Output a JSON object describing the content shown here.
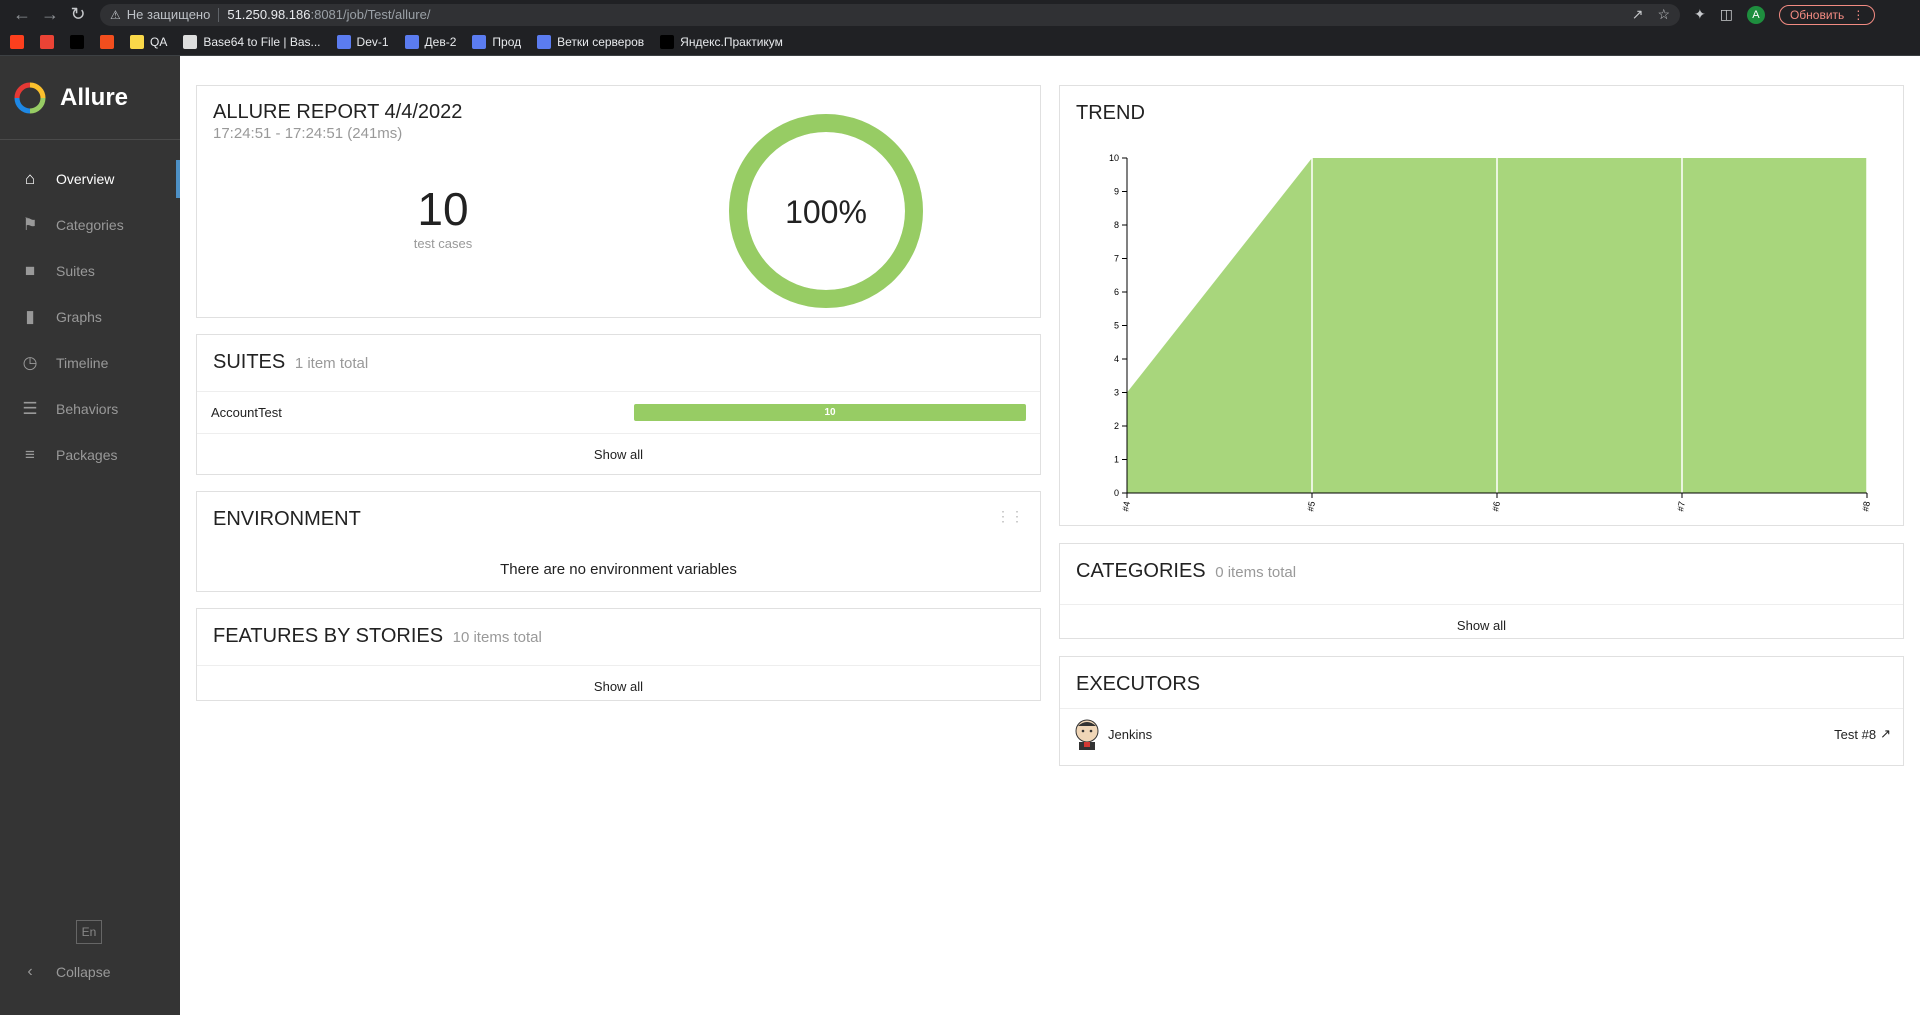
{
  "browser": {
    "security_label": "Не защищено",
    "url_host": "51.250.98.186",
    "url_path": ":8081/job/Test/allure/",
    "profile_initial": "A",
    "update_label": "Обновить"
  },
  "bookmarks": [
    {
      "label": "",
      "icon": "yandex-icon",
      "color": "#fc3f1d"
    },
    {
      "label": "",
      "icon": "gmail-icon",
      "color": "#ea4335"
    },
    {
      "label": "",
      "icon": "youtrack-icon",
      "color": "#000000"
    },
    {
      "label": "",
      "icon": "figma-icon",
      "color": "#f24e1e"
    },
    {
      "label": "QA",
      "icon": "folder-icon",
      "color": "#f9d849"
    },
    {
      "label": "Base64 to File | Bas...",
      "icon": "base64-icon",
      "color": "#dddddd"
    },
    {
      "label": "Dev-1",
      "icon": "page-icon",
      "color": "#5b7cf0"
    },
    {
      "label": "Дев-2",
      "icon": "page-icon",
      "color": "#5b7cf0"
    },
    {
      "label": "Прод",
      "icon": "page-icon",
      "color": "#5b7cf0"
    },
    {
      "label": "Ветки серверов",
      "icon": "page-icon",
      "color": "#5b7cf0"
    },
    {
      "label": "Яндекс.Практикум",
      "icon": "practicum-icon",
      "color": "#000000"
    }
  ],
  "sidebar": {
    "brand": "Allure",
    "items": [
      {
        "label": "Overview",
        "icon": "home-icon",
        "active": true
      },
      {
        "label": "Categories",
        "icon": "flag-icon",
        "active": false
      },
      {
        "label": "Suites",
        "icon": "briefcase-icon",
        "active": false
      },
      {
        "label": "Graphs",
        "icon": "bar-chart-icon",
        "active": false
      },
      {
        "label": "Timeline",
        "icon": "clock-icon",
        "active": false
      },
      {
        "label": "Behaviors",
        "icon": "list-icon",
        "active": false
      },
      {
        "label": "Packages",
        "icon": "align-left-icon",
        "active": false
      }
    ],
    "language": "En",
    "collapse_label": "Collapse"
  },
  "summary": {
    "title": "ALLURE REPORT 4/4/2022",
    "time_range": "17:24:51 - 17:24:51 (241ms)",
    "test_count": "10",
    "test_label": "test cases",
    "success_rate": "100%",
    "success_fraction": 1.0
  },
  "suites": {
    "title": "SUITES",
    "subtitle": "1 item total",
    "items": [
      {
        "name": "AccountTest",
        "count": "10"
      }
    ],
    "show_all": "Show all"
  },
  "environment": {
    "title": "ENVIRONMENT",
    "empty_text": "There are no environment variables"
  },
  "features": {
    "title": "FEATURES BY STORIES",
    "subtitle": "10 items total",
    "show_all": "Show all"
  },
  "trend": {
    "title": "TREND"
  },
  "categories": {
    "title": "CATEGORIES",
    "subtitle": "0 items total",
    "show_all": "Show all"
  },
  "executors": {
    "title": "EXECUTORS",
    "name": "Jenkins",
    "build": "Test #8"
  },
  "colors": {
    "passed": "#97cc64",
    "trend_fill": "#a8d67c",
    "sidebar_bg": "#343434",
    "active_indicator": "#4d90c5"
  },
  "chart_data": {
    "type": "area",
    "x": [
      "#4",
      "#5",
      "#6",
      "#7",
      "#8"
    ],
    "series": [
      {
        "values": [
          3,
          10,
          10,
          10,
          10
        ]
      }
    ],
    "ylim": [
      0,
      10
    ],
    "yticks": [
      "0",
      "1",
      "2",
      "3",
      "4",
      "5",
      "6",
      "7",
      "8",
      "9",
      "10"
    ],
    "title": "",
    "xlabel": "",
    "ylabel": ""
  }
}
